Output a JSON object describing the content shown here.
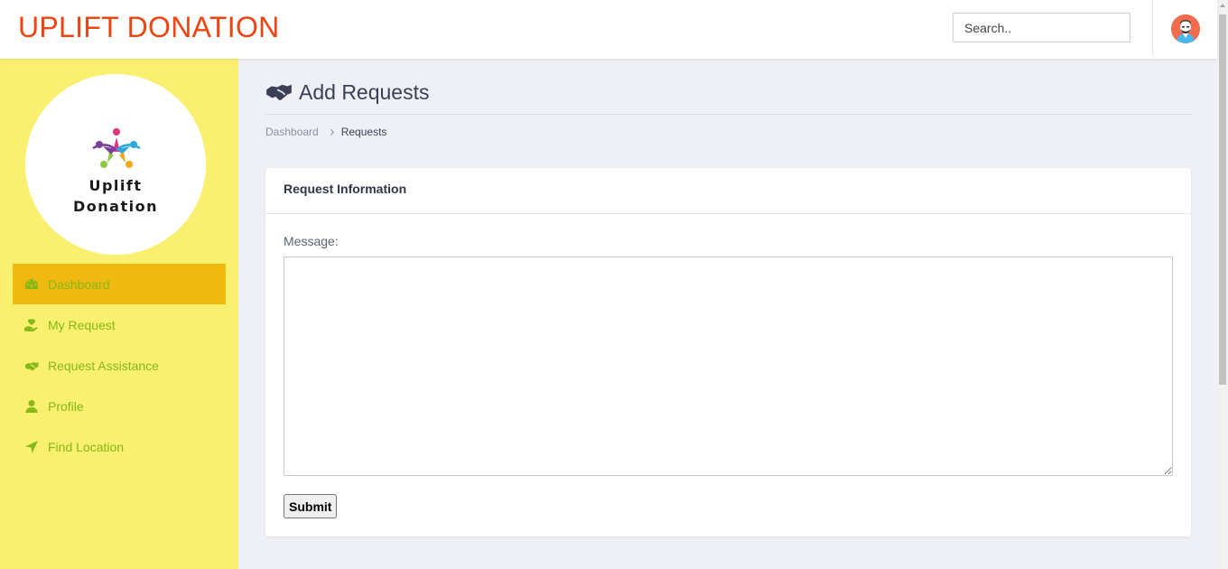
{
  "header": {
    "brand": "UPLIFT DONATION",
    "search_placeholder": "Search..",
    "search_value": ""
  },
  "sidebar": {
    "logo": {
      "line1": "Uplift",
      "line2": "Donation"
    },
    "items": [
      {
        "label": "Dashboard",
        "icon": "dashboard-gauge-icon",
        "active": true
      },
      {
        "label": "My Request",
        "icon": "hand-holding-heart-icon",
        "active": false
      },
      {
        "label": "Request Assistance",
        "icon": "handshake-icon",
        "active": false
      },
      {
        "label": "Profile",
        "icon": "user-icon",
        "active": false
      },
      {
        "label": "Find Location",
        "icon": "location-arrow-icon",
        "active": false
      }
    ]
  },
  "page": {
    "title": "Add Requests",
    "title_icon": "handshake-icon",
    "breadcrumb": {
      "parent": "Dashboard",
      "current": "Requests"
    }
  },
  "form": {
    "card_title": "Request Information",
    "message_label": "Message:",
    "message_value": "",
    "submit_label": "Submit"
  },
  "colors": {
    "brand": "#ee4411",
    "sidebar_bg": "#f8f06e",
    "sidebar_active": "#f0b90f",
    "sidebar_text": "#86b817",
    "page_bg": "#eef0f5",
    "title_text": "#3a4058"
  }
}
